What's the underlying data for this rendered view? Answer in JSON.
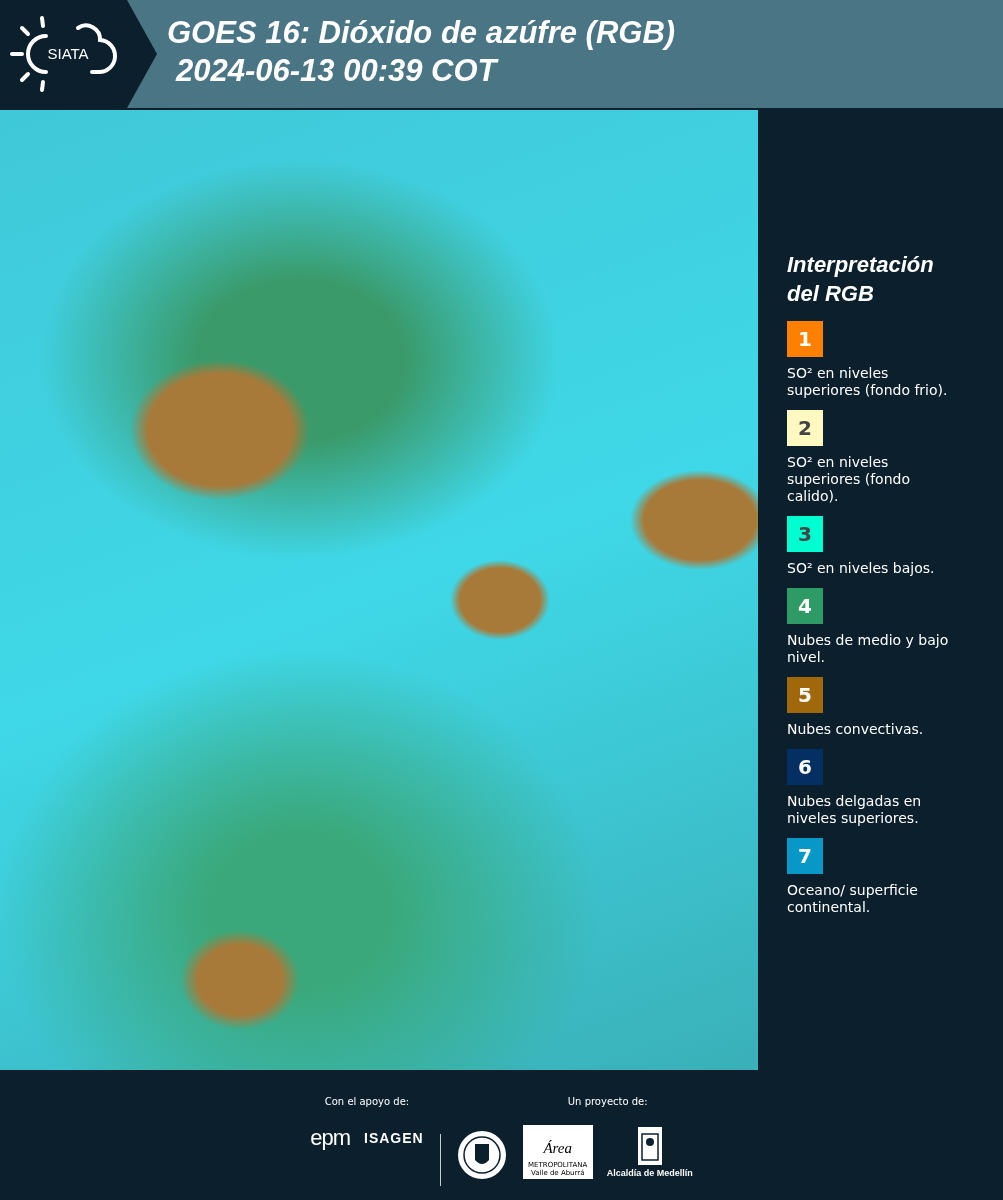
{
  "header": {
    "logo_text": "SIATA",
    "title_lines": [
      "GOES 16: Dióxido de azúfre (RGB)",
      "2024-06-13 00:39 COT"
    ]
  },
  "legend": {
    "title_lines": [
      "Interpretación",
      "del RGB"
    ],
    "items": [
      {
        "number": "1",
        "color": "#ff7f00",
        "text": "SO² en niveles superiores (fondo frio)."
      },
      {
        "number": "2",
        "color": "#fff8c0",
        "text": "SO² en niveles superiores (fondo calido)."
      },
      {
        "number": "3",
        "color": "#00ffd0",
        "text": "SO² en niveles bajos."
      },
      {
        "number": "4",
        "color": "#2e9a65",
        "text": "Nubes de medio y bajo nivel."
      },
      {
        "number": "5",
        "color": "#a0680a",
        "text": "Nubes convectivas."
      },
      {
        "number": "6",
        "color": "#032f63",
        "text": "Nubes delgadas en niveles superiores."
      },
      {
        "number": "7",
        "color": "#0798c8",
        "text": "Oceano/ superficie continental."
      }
    ]
  },
  "footer": {
    "support_label": "Con el apoyo de:",
    "support_logos": [
      "epm",
      "ISAGEN"
    ],
    "project_label": "Un proyecto de:",
    "area_logo": {
      "mark": "Área",
      "lines": [
        "METROPOLITANA",
        "Valle de Aburrá"
      ]
    },
    "city_logo": "Alcaldía de Medellín"
  }
}
